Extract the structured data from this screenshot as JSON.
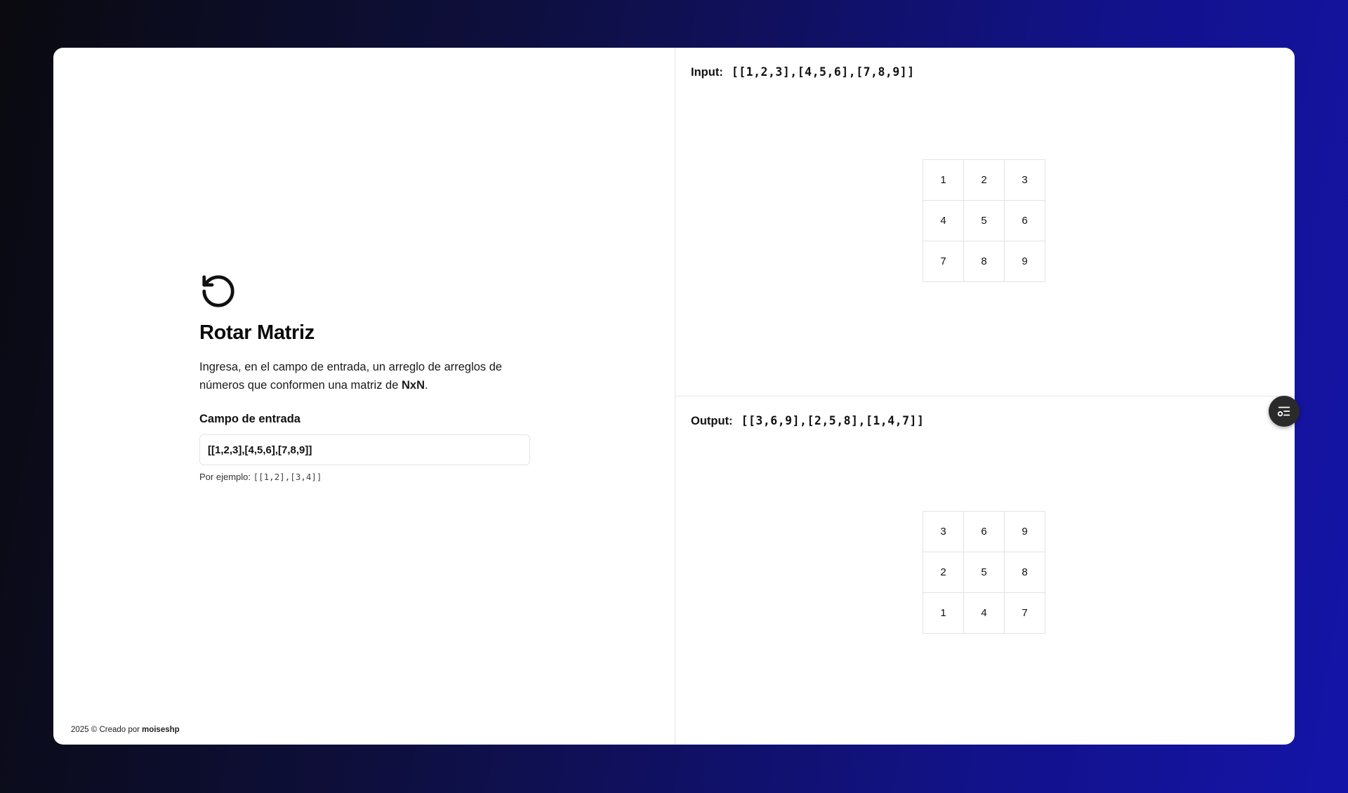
{
  "app": {
    "title": "Rotar Matriz",
    "description_part1": "Ingresa, en el campo de entrada, un arreglo de arreglos de números que conformen una matriz de ",
    "description_bold": "NxN",
    "description_end": "."
  },
  "input_field": {
    "label": "Campo de entrada",
    "value": "[[1,2,3],[4,5,6],[7,8,9]]",
    "hint_prefix": "Por ejemplo:",
    "hint_example": "[[1,2],[3,4]]"
  },
  "input_pane": {
    "label": "Input:",
    "value": "[[1,2,3],[4,5,6],[7,8,9]]",
    "matrix": [
      [
        "1",
        "2",
        "3"
      ],
      [
        "4",
        "5",
        "6"
      ],
      [
        "7",
        "8",
        "9"
      ]
    ]
  },
  "output_pane": {
    "label": "Output:",
    "value": "[[3,6,9],[2,5,8],[1,4,7]]",
    "matrix": [
      [
        "3",
        "6",
        "9"
      ],
      [
        "2",
        "5",
        "8"
      ],
      [
        "1",
        "4",
        "7"
      ]
    ]
  },
  "footer": {
    "text": "2025 © Creado por",
    "author": "moiseshp"
  },
  "icons": {
    "logo": "rotate-ccw-icon",
    "fab": "settings-list-icon"
  },
  "colors": {
    "background_start": "#0a0a0f",
    "background_end": "#1414a8",
    "card": "#ffffff",
    "fab": "#2a2a2a"
  }
}
